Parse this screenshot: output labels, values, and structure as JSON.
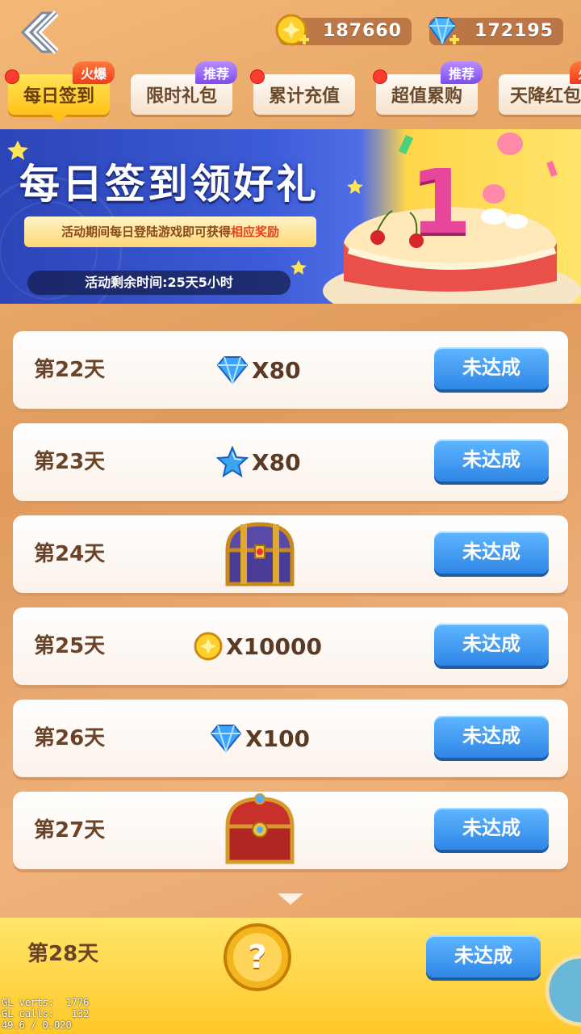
{
  "header": {
    "gold": "187660",
    "gems": "172195"
  },
  "tabs": [
    {
      "label": "每日签到",
      "badge": "火爆",
      "active": true
    },
    {
      "label": "限时礼包",
      "badge": "推荐"
    },
    {
      "label": "累计充值",
      "badge": ""
    },
    {
      "label": "超值累购",
      "badge": "推荐"
    },
    {
      "label": "天降红包",
      "badge": "火"
    }
  ],
  "banner": {
    "title": "每日签到领好礼",
    "subtitle_prefix": "活动期间每日登陆游戏即可获得",
    "subtitle_highlight": "相应奖励",
    "timer": "活动剩余时间:25天5小时",
    "cake_number": "1"
  },
  "rows": [
    {
      "day": "第22天",
      "reward_icon": "diamond-icon",
      "qty": "X80",
      "button": "未达成"
    },
    {
      "day": "第23天",
      "reward_icon": "star-icon",
      "qty": "X80",
      "button": "未达成"
    },
    {
      "day": "第24天",
      "reward_icon": "purple-chest-icon",
      "qty": "",
      "button": "未达成"
    },
    {
      "day": "第25天",
      "reward_icon": "gold-coin-icon",
      "qty": "X10000",
      "button": "未达成"
    },
    {
      "day": "第26天",
      "reward_icon": "diamond-icon",
      "qty": "X100",
      "button": "未达成"
    },
    {
      "day": "第27天",
      "reward_icon": "red-chest-icon",
      "qty": "",
      "button": "未达成"
    }
  ],
  "final_row": {
    "day": "第28天",
    "reward_icon": "mystery-coin-icon",
    "reward_symbol": "?",
    "button": "未达成"
  },
  "debug": {
    "line1": "GL verts:  1776",
    "line2": "GL calls:   132",
    "line3": "49.6 / 0.020"
  },
  "colors": {
    "accent_blue": "#2f86e6",
    "tab_active": "#ffc21a",
    "banner_blue": "#3c5bd6"
  }
}
